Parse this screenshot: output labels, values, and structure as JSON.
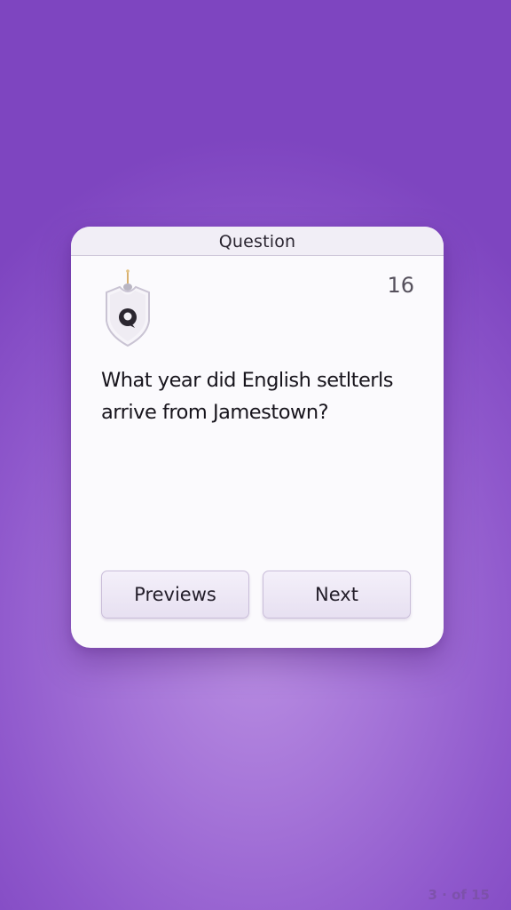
{
  "card": {
    "title": "Question",
    "counter": "16",
    "question_line1": "What year did English setlterls",
    "question_line2": "arrive from  Jamestown?"
  },
  "buttons": {
    "previous_label": "Previews",
    "next_label": "Next"
  },
  "pagination": {
    "indicator": "3 · of 15"
  },
  "icons": {
    "badge": "shield-badge-icon"
  },
  "colors": {
    "background": "#9a67d2",
    "card": "#fbfafd",
    "button": "#ece6f5"
  }
}
